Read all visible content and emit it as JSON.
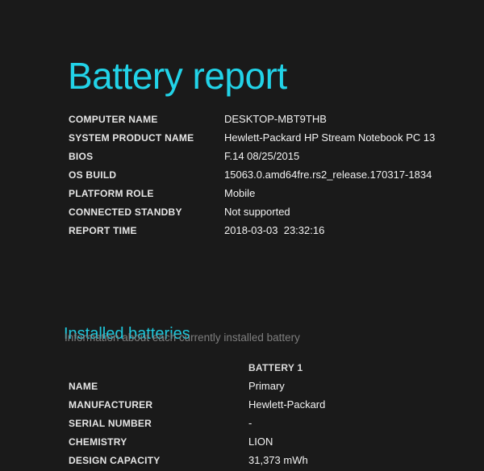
{
  "report": {
    "title": "Battery report",
    "system_info": {
      "rows": [
        {
          "label": "COMPUTER NAME",
          "value": "DESKTOP-MBT9THB"
        },
        {
          "label": "SYSTEM PRODUCT NAME",
          "value": "Hewlett-Packard HP Stream Notebook PC 13"
        },
        {
          "label": "BIOS",
          "value": "F.14 08/25/2015"
        },
        {
          "label": "OS BUILD",
          "value": "15063.0.amd64fre.rs2_release.170317-1834"
        },
        {
          "label": "PLATFORM ROLE",
          "value": "Mobile"
        },
        {
          "label": "CONNECTED STANDBY",
          "value": "Not supported"
        },
        {
          "label": "REPORT TIME",
          "value": "2018-03-03  23:32:16"
        }
      ]
    },
    "installed_batteries": {
      "heading": "Installed batteries",
      "subtitle": "Information about each currently installed battery",
      "column_header": "BATTERY 1",
      "rows": [
        {
          "label": "NAME",
          "value": "Primary"
        },
        {
          "label": "MANUFACTURER",
          "value": "Hewlett-Packard"
        },
        {
          "label": "SERIAL NUMBER",
          "value": "-"
        },
        {
          "label": "CHEMISTRY",
          "value": "LION"
        },
        {
          "label": "DESIGN CAPACITY",
          "value": "31,373 mWh"
        }
      ]
    }
  },
  "colors": {
    "background": "#1a1a1a",
    "accent_cyan": "#22d3e8",
    "heading_cyan": "#1fc8dc",
    "label_text": "#e6e6e6",
    "value_text": "#f2f2f2",
    "muted_text": "#7e7e7e"
  }
}
